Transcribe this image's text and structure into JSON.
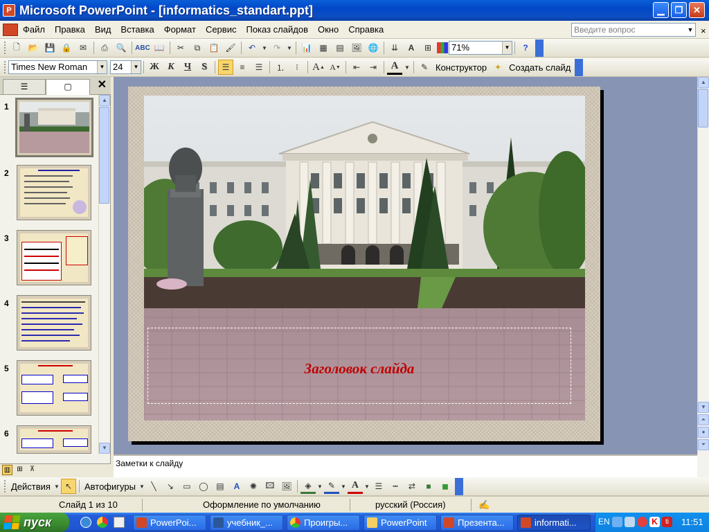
{
  "window": {
    "title": "Microsoft PowerPoint - [informatics_standart.ppt]",
    "app_icon": "P"
  },
  "menu": {
    "items": [
      "Файл",
      "Правка",
      "Вид",
      "Вставка",
      "Формат",
      "Сервис",
      "Показ слайдов",
      "Окно",
      "Справка"
    ],
    "help_placeholder": "Введите вопрос"
  },
  "standard_toolbar": {
    "zoom": "71%"
  },
  "format_toolbar": {
    "font": "Times New Roman",
    "size": "24",
    "bold": "Ж",
    "italic": "К",
    "underline": "Ч",
    "shadow": "S",
    "designer": "Конструктор",
    "new_slide": "Создать слайд"
  },
  "slides_pane": {
    "thumbs": [
      {
        "num": "1"
      },
      {
        "num": "2"
      },
      {
        "num": "3"
      },
      {
        "num": "4"
      },
      {
        "num": "5"
      },
      {
        "num": "6"
      }
    ]
  },
  "slide": {
    "title_placeholder": "Заголовок слайда",
    "title_color": "#c00000"
  },
  "notes": {
    "placeholder": "Заметки к слайду"
  },
  "drawing_toolbar": {
    "actions": "Действия",
    "autoshapes": "Автофигуры"
  },
  "status": {
    "slide": "Слайд 1 из 10",
    "design": "Оформление по умолчанию",
    "language": "русский (Россия)"
  },
  "taskbar": {
    "start": "пуск",
    "tasks": [
      "PowerPoi...",
      "учебник_...",
      "Проигры...",
      "PowerPoint",
      "Презента...",
      "informati..."
    ],
    "lang": "EN",
    "clock": "11:51"
  },
  "colors": {
    "title_bar": "#0148c8",
    "taskbar": "#245edb",
    "start_button": "#3a8a30",
    "slide_area": "#8894b3"
  }
}
